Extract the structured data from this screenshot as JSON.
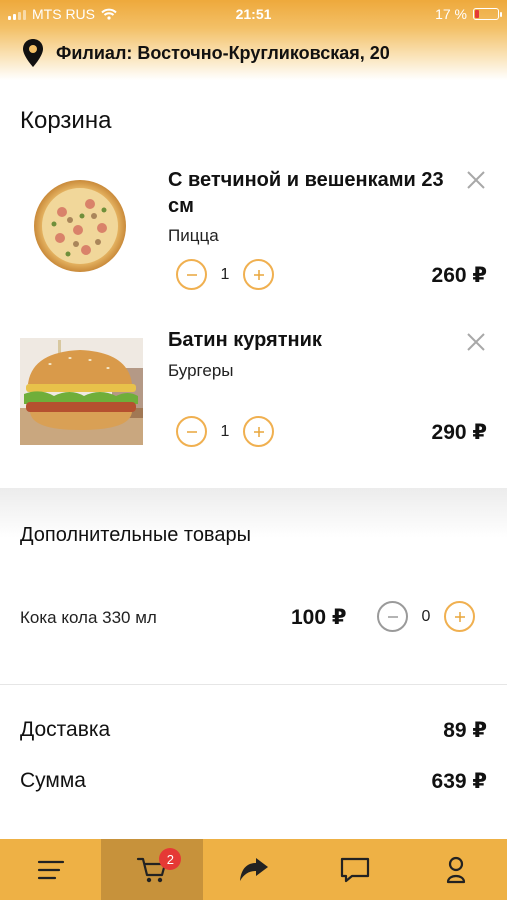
{
  "status_bar": {
    "carrier": "MTS RUS",
    "time": "21:51",
    "battery": "17 %",
    "battery_level": 0.17
  },
  "branch": {
    "label": "Филиал: Восточно-Кругликовская, 20",
    "icon": "location-pin-icon"
  },
  "cart": {
    "title": "Корзина",
    "items": [
      {
        "name": "С ветчиной и вешенками 23 см",
        "category": "Пицца",
        "quantity": "1",
        "price": "260 ₽",
        "image": "pizza-image"
      },
      {
        "name": "Батин курятник",
        "category": "Бургеры",
        "quantity": "1",
        "price": "290 ₽",
        "image": "burger-image"
      }
    ]
  },
  "extras": {
    "title": "Дополнительные товары",
    "items": [
      {
        "name": "Кока кола 330 мл",
        "price": "100 ₽",
        "quantity": "0"
      }
    ]
  },
  "summary": {
    "delivery_label": "Доставка",
    "delivery_value": "89 ₽",
    "total_label": "Сумма",
    "total_value": "639 ₽"
  },
  "tabbar": {
    "tabs": [
      {
        "name": "menu",
        "icon": "menu-icon"
      },
      {
        "name": "cart",
        "icon": "cart-icon",
        "badge": "2",
        "active": true
      },
      {
        "name": "share",
        "icon": "share-arrow-icon"
      },
      {
        "name": "chat",
        "icon": "chat-icon"
      },
      {
        "name": "profile",
        "icon": "profile-icon"
      }
    ]
  },
  "colors": {
    "accent": "#eeb145",
    "accent_dark": "#c7923b",
    "badge": "#e53935",
    "button_border": "#f0b050"
  }
}
